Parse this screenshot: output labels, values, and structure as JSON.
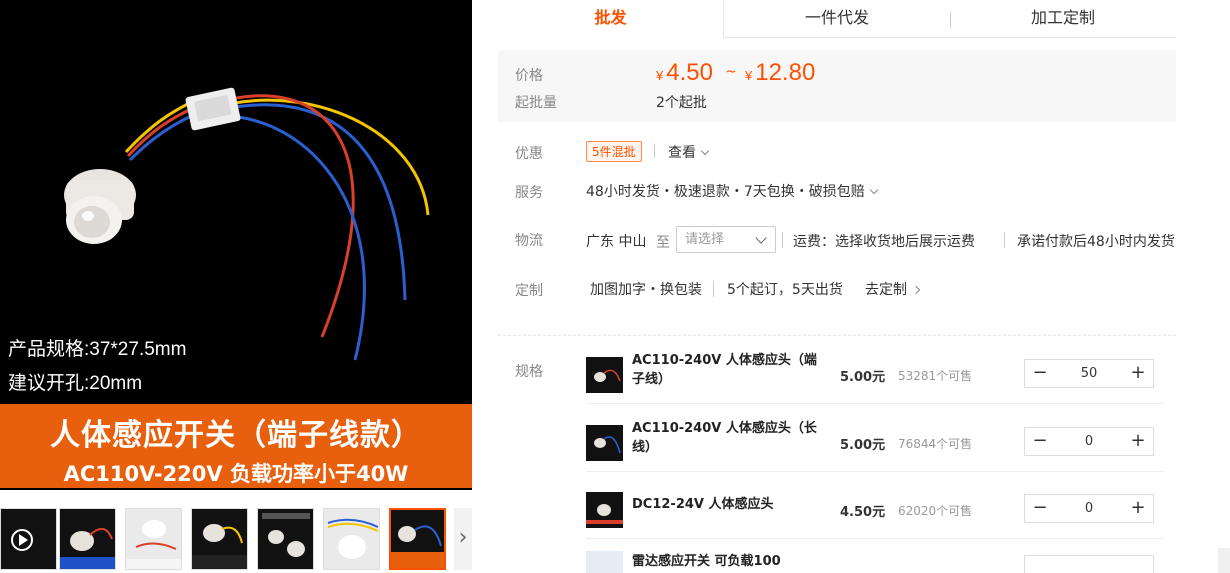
{
  "gallery": {
    "spec_size": "产品规格:37*27.5mm",
    "spec_hole": "建议开孔:20mm",
    "banner_title": "人体感应开关（端子线款）",
    "banner_sub": "AC110V-220V  负载功率小于40W",
    "next_arrow": "›",
    "thumbnails": [
      "video-thumb",
      "thumb-2",
      "thumb-3",
      "thumb-4",
      "thumb-5",
      "thumb-6",
      "thumb-7",
      "thumb-8"
    ]
  },
  "tabs": [
    {
      "label": "批发",
      "active": true
    },
    {
      "label": "一件代发",
      "active": false
    },
    {
      "label": "加工定制",
      "active": false
    }
  ],
  "price": {
    "label": "价格",
    "currency": "¥",
    "min": "4.50",
    "separator": "~",
    "max": "12.80",
    "moq_label": "起批量",
    "moq_value": "2个起批"
  },
  "promo": {
    "label": "优惠",
    "badge": "5件混批",
    "view": "查看"
  },
  "service": {
    "label": "服务",
    "value": "48小时发货・极速退款・7天包换・破损包赔"
  },
  "logistics": {
    "label": "物流",
    "origin": "广东 中山",
    "to": "至",
    "select_placeholder": "请选择",
    "fee": "运费：选择收货地后展示运费",
    "promise": "承诺付款后48小时内发货"
  },
  "custom": {
    "label": "定制",
    "options": "加图加字・换包装",
    "terms": "5个起订，5天出货",
    "link": "去定制"
  },
  "sku": {
    "label": "规格",
    "items": [
      {
        "name": "AC110-240V 人体感应头（端子线）",
        "price": "5.00元",
        "stock": "53281个可售",
        "qty": "50"
      },
      {
        "name": "AC110-240V 人体感应头（长线）",
        "price": "5.00元",
        "stock": "76844个可售",
        "qty": "0"
      },
      {
        "name": "DC12-24V 人体感应头",
        "price": "4.50元",
        "stock": "62020个可售",
        "qty": "0"
      },
      {
        "name": "雷达感应开关 可负载100",
        "price": "",
        "stock": "",
        "qty": ""
      }
    ],
    "minus": "−",
    "plus": "+"
  },
  "colors": {
    "accent": "#ff5000",
    "banner": "#e8600e"
  }
}
